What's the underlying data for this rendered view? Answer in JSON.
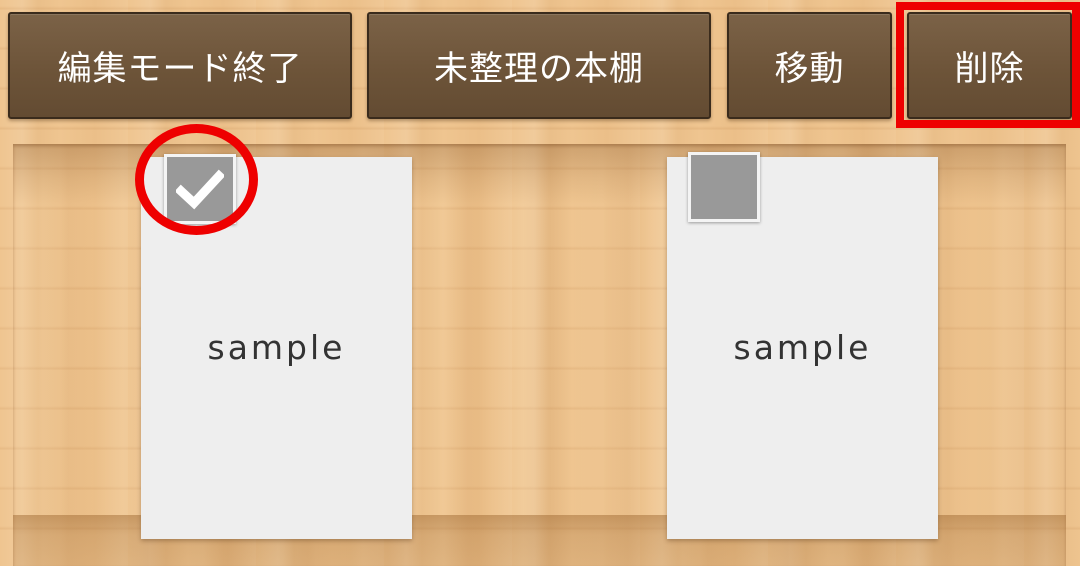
{
  "toolbar": {
    "exit_edit_mode_label": "編集モード終了",
    "unsorted_shelf_label": "未整理の本棚",
    "move_label": "移動",
    "delete_label": "削除"
  },
  "books": [
    {
      "title": "sample",
      "checked": true
    },
    {
      "title": "sample",
      "checked": false
    }
  ],
  "colors": {
    "button_bg": "#6d5439",
    "highlight": "#ee0000",
    "checkbox_bg": "#999999",
    "book_bg": "#eeeeee"
  },
  "icons": {
    "check": "check-icon"
  }
}
